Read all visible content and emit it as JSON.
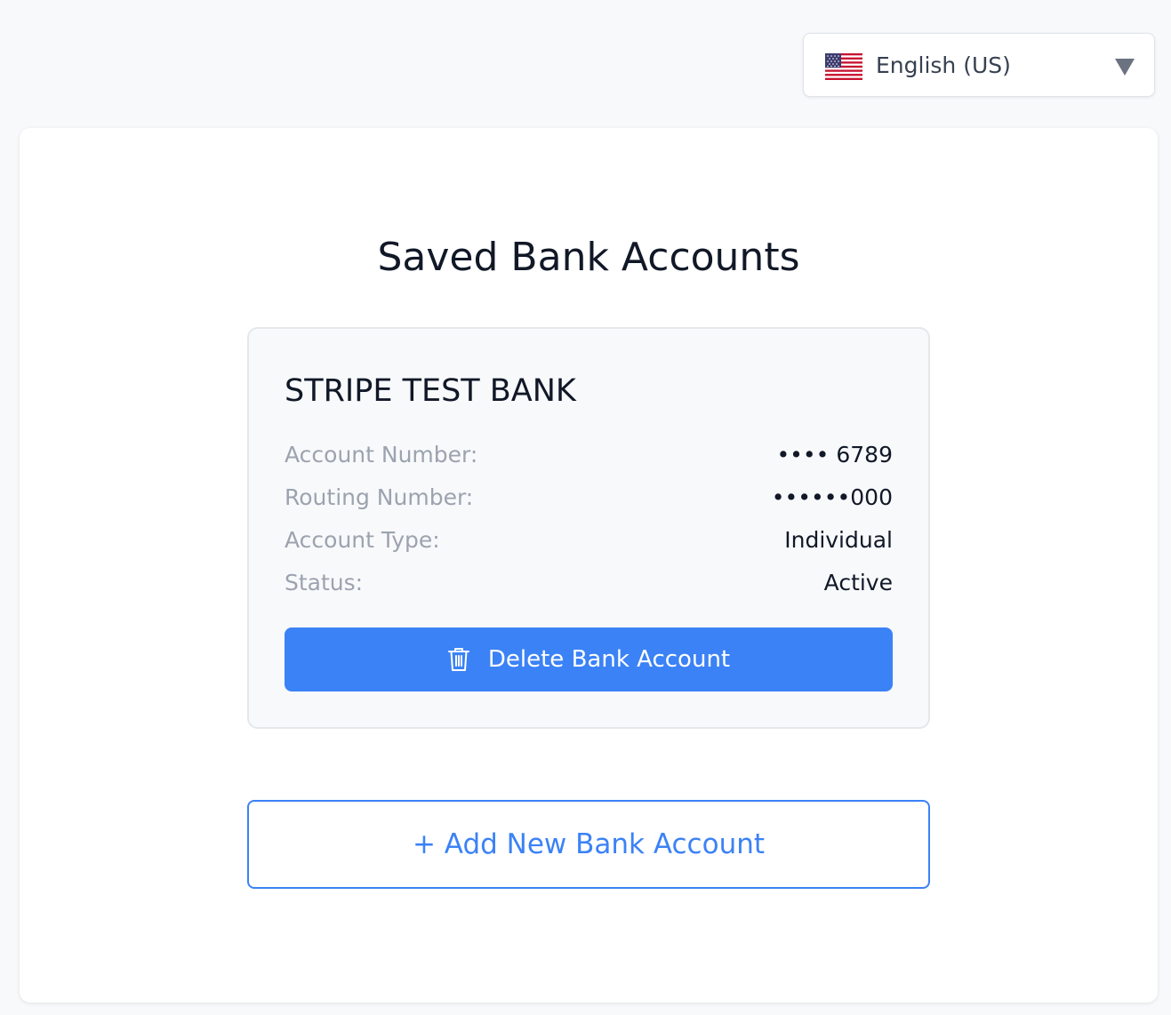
{
  "language_selector": {
    "flag_icon": "us-flag-icon",
    "selected_language": "English (US)",
    "chevron_icon": "chevron-down-icon"
  },
  "page": {
    "title": "Saved Bank Accounts"
  },
  "bank_account": {
    "bank_name": "STRIPE TEST BANK",
    "details": [
      {
        "label": "Account Number:",
        "value": "•••• 6789"
      },
      {
        "label": "Routing Number:",
        "value": "••••••000"
      },
      {
        "label": "Account Type:",
        "value": "Individual"
      },
      {
        "label": "Status:",
        "value": "Active"
      }
    ],
    "delete_button": {
      "icon": "trash-icon",
      "label": "Delete Bank Account"
    }
  },
  "add_button": {
    "label": "+ Add New Bank Account"
  },
  "colors": {
    "accent": "#3b82f6",
    "background": "#f8f9fb",
    "label_gray": "#9ca3af",
    "text_dark": "#111827"
  }
}
